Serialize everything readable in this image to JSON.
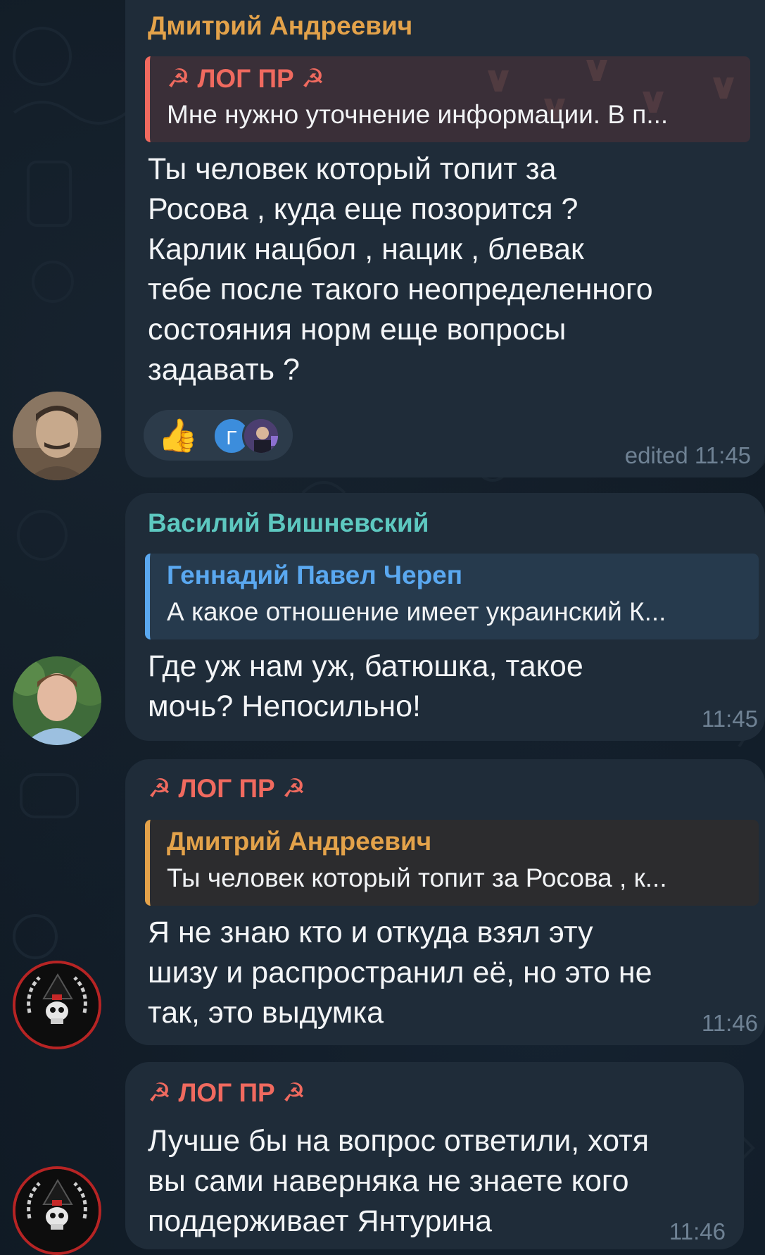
{
  "colors": {
    "background": "#101a24",
    "bubble": "#1f2c39",
    "name_orange": "#e3a24a",
    "name_teal": "#5dc8c0",
    "name_red": "#f06a5f",
    "reply_blue": "#5aa8f0",
    "timestamp": "#6f8294"
  },
  "messages": [
    {
      "sender": "Дмитрий Андреевич",
      "reply": {
        "name": "☭ ЛОГ ПР ☭",
        "text": "Мне нужно уточнение информации. В п..."
      },
      "text_lines": [
        "Ты человек который топит за",
        "Росова , куда еще позорится ?",
        "Карлик нацбол , нацик , блевак",
        "тебе после такого неопределенного",
        "состояния норм еще вопросы",
        "задавать ?"
      ],
      "reactions": {
        "emoji": "👍",
        "avatar_letter": "Г"
      },
      "time": "edited 11:45"
    },
    {
      "sender": "Василий Вишневский",
      "reply": {
        "name": "Геннадий Павел Череп",
        "text": "А какое отношение имеет украинский К..."
      },
      "text_lines": [
        "Где уж нам уж, батюшка, такое",
        "мочь? Непосильно!"
      ],
      "time": "11:45"
    },
    {
      "sender": "☭ ЛОГ ПР ☭",
      "reply": {
        "name": "Дмитрий Андреевич",
        "text": "Ты человек который топит за Росова , к..."
      },
      "text_lines": [
        "Я не знаю кто и откуда взял эту",
        "шизу и распространил её, но это не",
        "так, это выдумка"
      ],
      "time": "11:46"
    },
    {
      "sender": "☭ ЛОГ ПР ☭",
      "text_lines": [
        "Лучше бы на вопрос ответили, хотя",
        "вы сами наверняка не знаете кого",
        "поддерживает Янтурина"
      ],
      "time": "11:46"
    }
  ]
}
